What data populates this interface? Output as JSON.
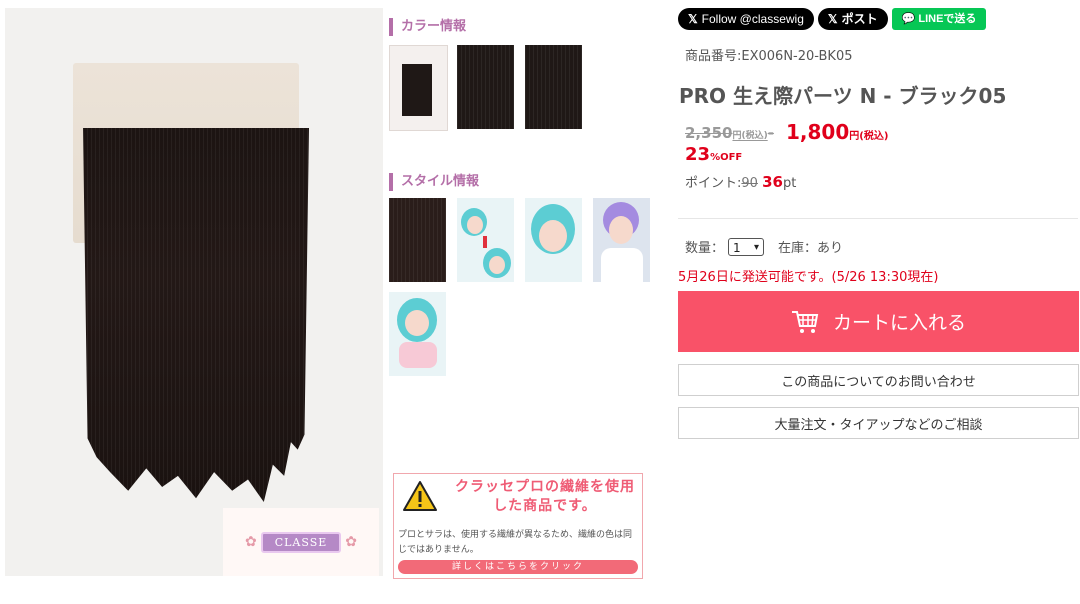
{
  "main_image": {
    "logo_text": "CLASSE"
  },
  "color_section": {
    "title": "カラー情報"
  },
  "style_section": {
    "title": "スタイル情報"
  },
  "warning": {
    "title": "クラッセプロの繊維を使用した商品です。",
    "body": "プロとサラは、使用する繊維が異なるため、繊維の色は同じではありません。",
    "link": "詳しくはこちらをクリック"
  },
  "social": {
    "follow": "Follow @classewig",
    "post": "ポスト",
    "line": "LINEで送る"
  },
  "product": {
    "code": "商品番号:EX006N-20-BK05",
    "title": "PRO 生え際パーツ N - ブラック05",
    "old_price": "2,350",
    "old_price_unit": "円(税込)",
    "price_sep": "-",
    "new_price": "1,800",
    "new_price_unit": "円(税込)",
    "discount": "23",
    "discount_unit": "%OFF",
    "points_label": "ポイント:",
    "points_old": "90",
    "points_new": "36",
    "points_unit": "pt"
  },
  "order": {
    "qty_label": "数量：",
    "qty_value": "1",
    "stock_label": "在庫：あり",
    "ship_note": "5月26日に発送可能です。(5/26 13:30現在)",
    "cart_button": "カートに入れる",
    "inquiry_button": "この商品についてのお問い合わせ",
    "bulk_button": "大量注文・タイアップなどのご相談"
  },
  "colors": {
    "accent": "#f95268",
    "section": "#b46fa8",
    "price": "#e0001b",
    "line_green": "#06c755"
  }
}
